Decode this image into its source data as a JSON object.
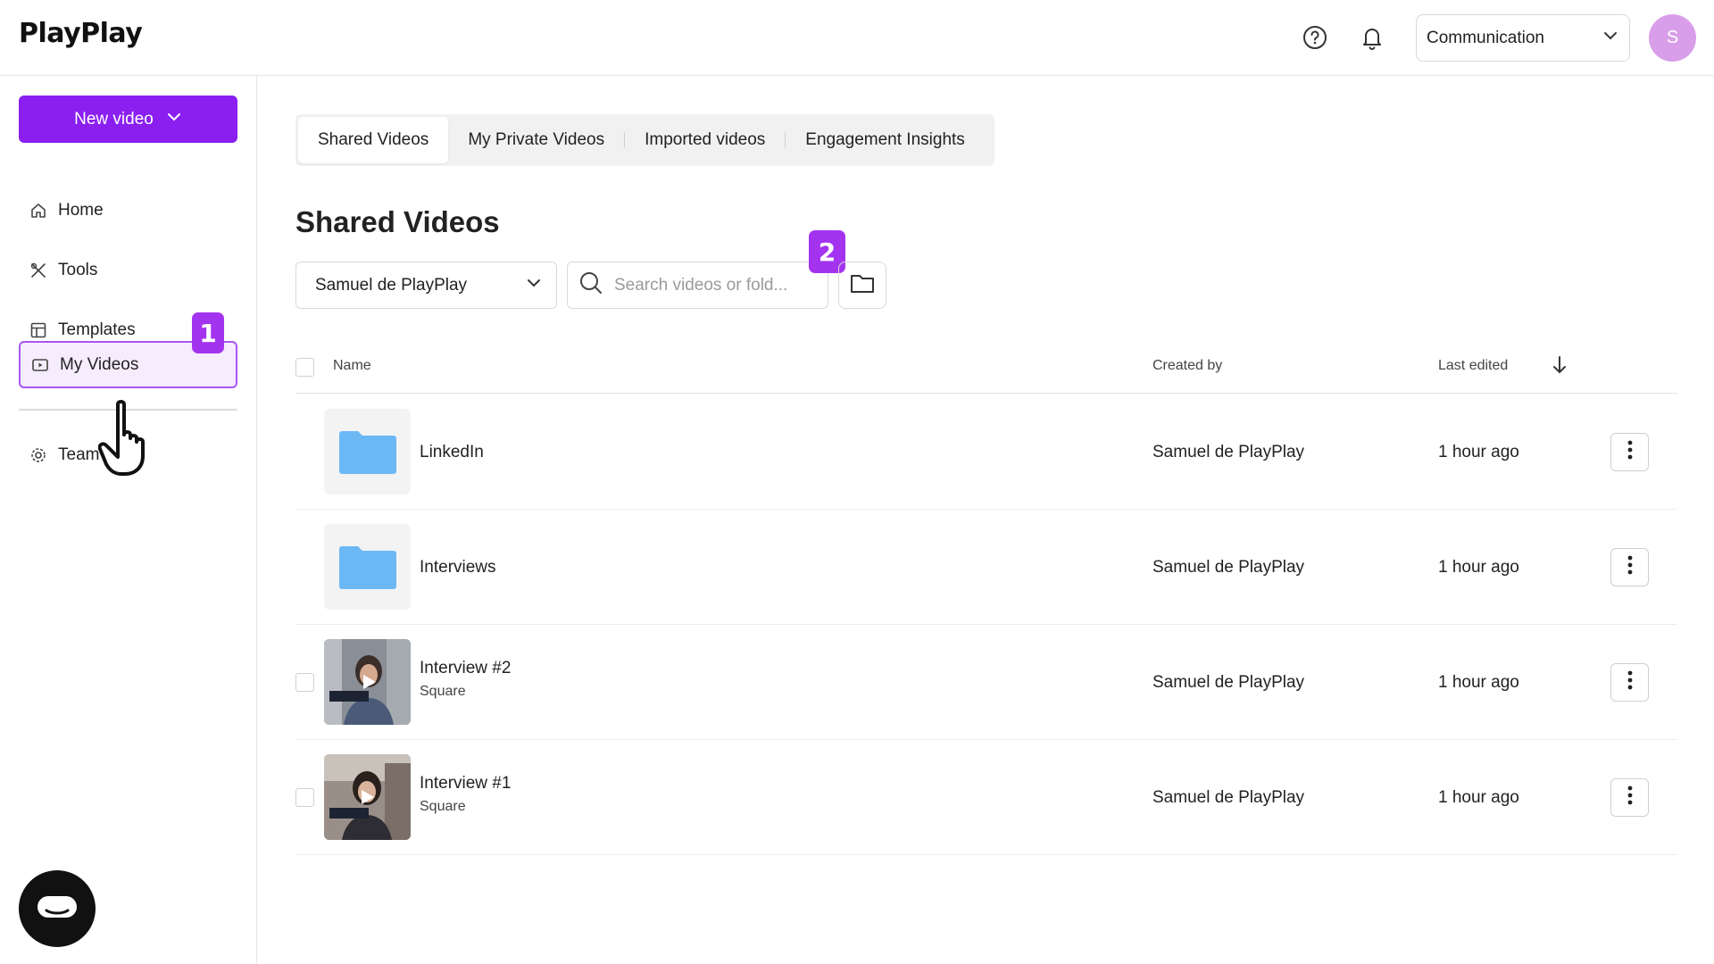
{
  "app": {
    "logo": "PlayPlay"
  },
  "header": {
    "workspace": "Communication",
    "avatar_initial": "S"
  },
  "sidebar": {
    "new_video": "New video",
    "items": [
      {
        "label": "Home",
        "icon": "home-icon"
      },
      {
        "label": "Tools",
        "icon": "tools-icon"
      },
      {
        "label": "Templates",
        "icon": "templates-icon"
      },
      {
        "label": "My Videos",
        "icon": "video-icon",
        "active": true
      },
      {
        "label": "Team",
        "icon": "gear-icon"
      }
    ]
  },
  "badges": {
    "one": "1",
    "two": "2"
  },
  "tabs": [
    "Shared Videos",
    "My Private Videos",
    "Imported videos",
    "Engagement Insights"
  ],
  "main": {
    "title": "Shared Videos",
    "owner_filter": "Samuel de PlayPlay",
    "search_placeholder": "Search videos or fold..."
  },
  "table": {
    "columns": {
      "name": "Name",
      "created_by": "Created by",
      "last_edited": "Last edited"
    },
    "rows": [
      {
        "type": "folder",
        "name": "LinkedIn",
        "created_by": "Samuel de PlayPlay",
        "last_edited": "1 hour ago"
      },
      {
        "type": "folder",
        "name": "Interviews",
        "created_by": "Samuel de PlayPlay",
        "last_edited": "1 hour ago"
      },
      {
        "type": "video",
        "name": "Interview #2",
        "format": "Square",
        "created_by": "Samuel de PlayPlay",
        "last_edited": "1 hour ago"
      },
      {
        "type": "video",
        "name": "Interview #1",
        "format": "Square",
        "created_by": "Samuel de PlayPlay",
        "last_edited": "1 hour ago"
      }
    ]
  },
  "colors": {
    "accent": "#8a1ff0",
    "badge": "#a433f0",
    "folder": "#6cb8f5"
  }
}
